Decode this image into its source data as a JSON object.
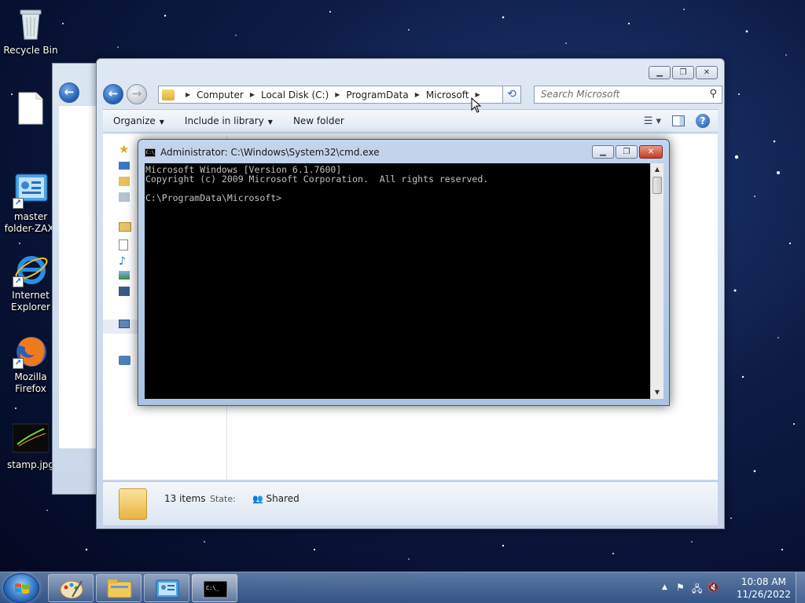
{
  "desktop": {
    "icons": [
      {
        "label": "Recycle Bin",
        "icon": "recycle-bin-icon"
      },
      {
        "label": "",
        "icon": "blank-file-icon"
      },
      {
        "label": "master folder-ZAX.",
        "icon": "control-panel-icon"
      },
      {
        "label": "Internet Explorer",
        "icon": "internet-explorer-icon"
      },
      {
        "label": "Mozilla Firefox",
        "icon": "firefox-icon"
      },
      {
        "label": "stamp.jpg",
        "icon": "image-file-icon"
      }
    ]
  },
  "explorer": {
    "breadcrumb": [
      "Computer",
      "Local Disk (C:)",
      "ProgramData",
      "Microsoft"
    ],
    "search_placeholder": "Search Microsoft",
    "toolbar": {
      "organize": "Organize",
      "include_in_library": "Include in library",
      "new_folder": "New folder"
    },
    "status": {
      "item_count": "13 items",
      "state_label": "State:",
      "state_value": "Shared"
    }
  },
  "cmd": {
    "title": "Administrator: C:\\Windows\\System32\\cmd.exe",
    "lines": [
      "Microsoft Windows [Version 6.1.7600]",
      "Copyright (c) 2009 Microsoft Corporation.  All rights reserved.",
      "",
      "C:\\ProgramData\\Microsoft>"
    ]
  },
  "taskbar": {
    "clock_time": "10:08 AM",
    "clock_date": "11/26/2022"
  },
  "colors": {
    "desktop_bg": "#0e1d46",
    "console_bg": "#000000",
    "console_text": "#c0c0c0",
    "close_red": "#c43b24"
  }
}
